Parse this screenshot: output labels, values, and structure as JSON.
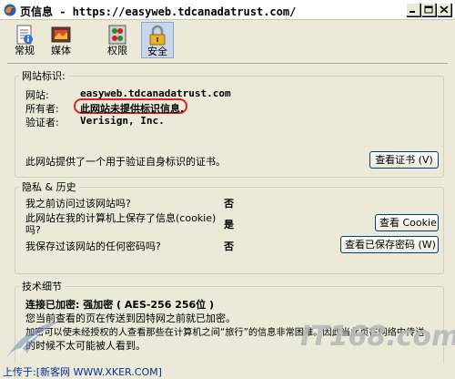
{
  "window": {
    "title": "页信息 - https://easyweb.tdcanadatrust.com/"
  },
  "toolbar": {
    "items": [
      {
        "label": "常规",
        "icon": "page-info-icon"
      },
      {
        "label": "媒体",
        "icon": "media-icon"
      },
      {
        "label": "权限",
        "icon": "permissions-icon"
      },
      {
        "label": "安全",
        "icon": "lock-icon",
        "selected": true
      }
    ]
  },
  "identity": {
    "legend": "网站标识:",
    "website_label": "网站:",
    "website_value": "easyweb.tdcanadatrust.com",
    "owner_label": "所有者:",
    "owner_value": "此网站未提供标识信息.",
    "verifier_label": "验证者:",
    "verifier_value": "Verisign, Inc.",
    "cert_text": "此网站提供了一个用于验证自身标识的证书。",
    "cert_button": "查看证书 (V)"
  },
  "privacy": {
    "legend": "隐私 & 历史",
    "q1": "我之前访问过该网站吗?",
    "a1": "否",
    "q2_line1": "此网站在我的计算机上保存了信息(cookie)",
    "q2_line2": "吗?",
    "a2": "是",
    "cookie_button": "查看 Cookie",
    "q3": "我保存过该网站的任何密码吗?",
    "a3": "否",
    "password_button": "查看已保存密码 (W)"
  },
  "technical": {
    "legend": "技术细节",
    "line1": "连接已加密: 强加密 ( AES-256 256位 )",
    "line2": "您当前查看的页在传送到因特网之前就已加密。",
    "line3": "加密可以使未经授权的人查看那些在计算机之间“旅行”的信息非常困难。因此当此页在网络中传送",
    "line4": "的时候不太可能被人看到。"
  },
  "footer": {
    "text": "上传于:[新客网 WWW.XKER.COM]"
  },
  "watermark": {
    "text": "IT168.com"
  },
  "colors": {
    "highlight_oval": "#e02020",
    "window_bg": "#ece9d8"
  }
}
